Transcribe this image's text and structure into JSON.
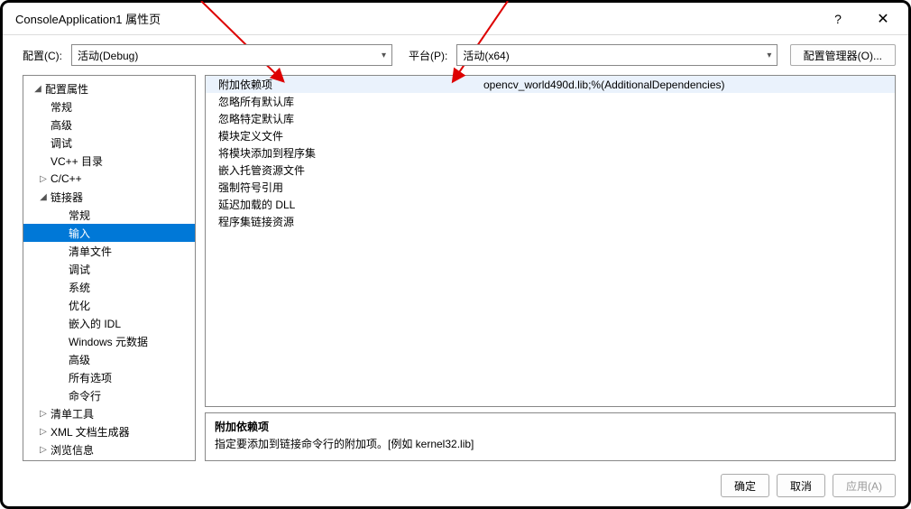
{
  "window": {
    "title": "ConsoleApplication1 属性页"
  },
  "toolbar": {
    "config_label": "配置(C):",
    "config_value": "活动(Debug)",
    "platform_label": "平台(P):",
    "platform_value": "活动(x64)",
    "config_manager": "配置管理器(O)..."
  },
  "tree": {
    "root": "配置属性",
    "items_l2": [
      "常规",
      "高级",
      "调试",
      "VC++ 目录"
    ],
    "cxx": "C/C++",
    "linker": "链接器",
    "linker_children": [
      "常规",
      "输入",
      "清单文件",
      "调试",
      "系统",
      "优化",
      "嵌入的 IDL",
      "Windows 元数据",
      "高级",
      "所有选项",
      "命令行"
    ],
    "manifest": "清单工具",
    "xmlgen": "XML 文档生成器",
    "browse": "浏览信息"
  },
  "props": {
    "rows": [
      {
        "name": "附加依赖项",
        "value": "opencv_world490d.lib;%(AdditionalDependencies)"
      },
      {
        "name": "忽略所有默认库",
        "value": ""
      },
      {
        "name": "忽略特定默认库",
        "value": ""
      },
      {
        "name": "模块定义文件",
        "value": ""
      },
      {
        "name": "将模块添加到程序集",
        "value": ""
      },
      {
        "name": "嵌入托管资源文件",
        "value": ""
      },
      {
        "name": "强制符号引用",
        "value": ""
      },
      {
        "name": "延迟加载的 DLL",
        "value": ""
      },
      {
        "name": "程序集链接资源",
        "value": ""
      }
    ]
  },
  "desc": {
    "title": "附加依赖项",
    "body": "指定要添加到链接命令行的附加项。[例如 kernel32.lib]"
  },
  "buttons": {
    "ok": "确定",
    "cancel": "取消",
    "apply": "应用(A)"
  }
}
